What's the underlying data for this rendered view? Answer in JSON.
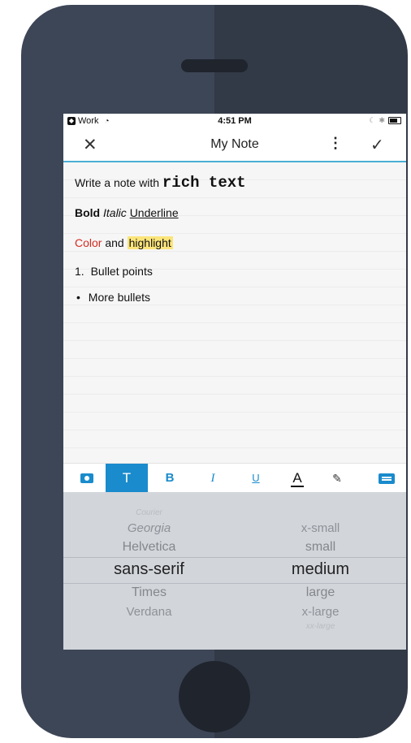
{
  "status_bar": {
    "carrier": "Work",
    "time": "4:51 PM"
  },
  "header": {
    "close_icon": "close-icon",
    "title": "My Note",
    "more_icon": "more-vertical-icon",
    "done_icon": "check-icon"
  },
  "note": {
    "line1_prefix": "Write a note with ",
    "line1_rich": "rich text",
    "bold": "Bold",
    "italic": "Italic",
    "underline": "Underline",
    "color_word": "Color",
    "and_word": "and",
    "highlight_word": "highlight",
    "list_number": "1.",
    "list_item": "Bullet points",
    "bullet_glyph": "•",
    "bullet_item": "More bullets"
  },
  "toolbar": {
    "text_label": "T",
    "bold_label": "B",
    "italic_label": "I",
    "underline_label": "U",
    "color_label": "A",
    "highlight_glyph": "✎",
    "active_tool": "text",
    "accent_color": "#1a8bcc"
  },
  "picker": {
    "fonts": [
      "Courier",
      "Georgia",
      "Helvetica",
      "sans-serif",
      "Times",
      "Verdana"
    ],
    "selected_font": "sans-serif",
    "sizes": [
      "x-small",
      "small",
      "medium",
      "large",
      "x-large",
      "xx-large"
    ],
    "selected_size": "medium"
  },
  "colors": {
    "nav_underline": "#4aaed3",
    "text_red": "#d42b20",
    "highlight_yellow": "#fbe57b",
    "picker_bg": "#d2d5da"
  }
}
